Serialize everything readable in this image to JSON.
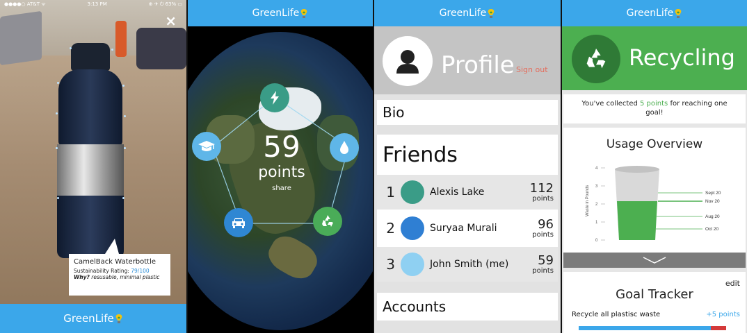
{
  "app_name": "GreenLife",
  "ar_view": {
    "status_left": "●●●●○ AT&T ᯤ",
    "status_time": "3:13 PM",
    "status_right": "⊕ ✈ ⏻ 63% ▭",
    "close": "×",
    "item_name": "CamelBack Waterbottle",
    "rating_label": "Sustainability Rating:",
    "rating_value": "79/100",
    "why_label": "Why?",
    "why_text": "resusable, minimal plastic",
    "chevron": "︿"
  },
  "globe_view": {
    "points": "59",
    "points_label": "points",
    "share": "share",
    "categories": [
      {
        "icon": "lightning-icon",
        "color": "#3a9c87"
      },
      {
        "icon": "water-drop-icon",
        "color": "#5fb6e8"
      },
      {
        "icon": "recycle-icon",
        "color": "#4aac58"
      },
      {
        "icon": "car-icon",
        "color": "#2f87d3"
      },
      {
        "icon": "graduation-cap-icon",
        "color": "#5fb6e8"
      }
    ]
  },
  "profile": {
    "title": "Profile",
    "sign_out": "Sign out",
    "bio": "Bio",
    "friends_title": "Friends",
    "friends": [
      {
        "rank": "1",
        "name": "Alexis Lake",
        "points": "112",
        "unit": "points",
        "color": "#3a9c87"
      },
      {
        "rank": "2",
        "name": "Suryaa Murali",
        "points": "96",
        "unit": "points",
        "color": "#2f7fd3"
      },
      {
        "rank": "3",
        "name": "John Smith (me)",
        "points": "59",
        "unit": "points",
        "color": "#8fd0f2"
      }
    ],
    "accounts": "Accounts"
  },
  "recycling": {
    "title": "Recycling",
    "msg_before": "You've collected ",
    "msg_points": "5 points",
    "msg_after": " for reaching one goal!",
    "usage_title": "Usage Overview",
    "y_axis_label": "Waste in Pounds",
    "y_ticks": [
      "4",
      "3",
      "2",
      "1",
      "0"
    ],
    "date_labels": [
      "Sept 20",
      "Nov 20",
      "Aug 20",
      "Oct 20"
    ],
    "toggle": "﹀",
    "goal_title": "Goal Tracker",
    "edit": "edit",
    "goal_item": "Recycle all plastisc waste",
    "goal_reward": "+5 points"
  }
}
